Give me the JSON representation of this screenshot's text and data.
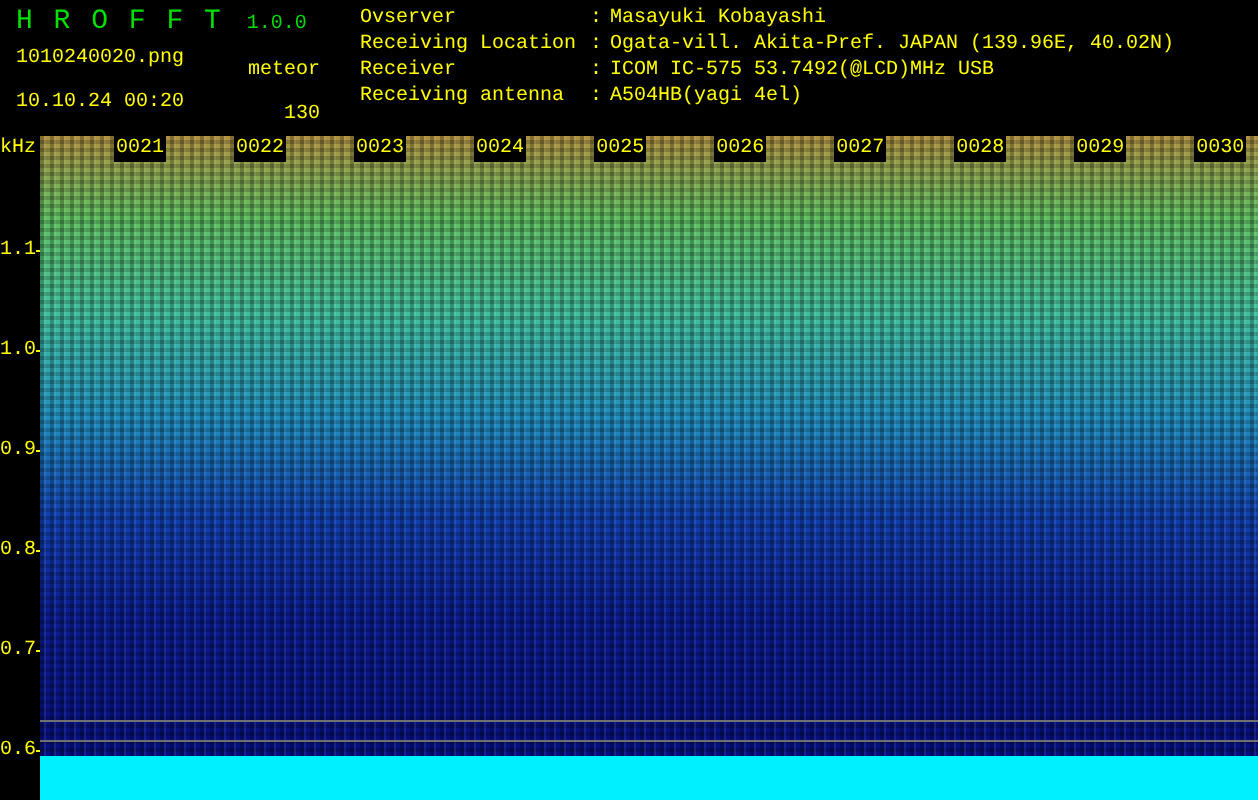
{
  "app": {
    "name": "H R O F F T",
    "version": "1.0.0"
  },
  "file": {
    "name": "1010240020.png",
    "datetime": "10.10.24 00:20"
  },
  "meteor": {
    "label": "meteor",
    "count": "130"
  },
  "info": [
    {
      "label": "Ovserver",
      "separator": ":",
      "value": "Masayuki Kobayashi"
    },
    {
      "label": "Receiving Location",
      "separator": ":",
      "value": "Ogata-vill. Akita-Pref. JAPAN (139.96E, 40.02N)"
    },
    {
      "label": "Receiver",
      "separator": ":",
      "value": "ICOM IC-575 53.7492(@LCD)MHz USB"
    },
    {
      "label": "Receiving antenna",
      "separator": ":",
      "value": "A504HB(yagi 4el)"
    }
  ],
  "spectrogram": {
    "unit": "kHz",
    "time_labels": [
      "0021",
      "0022",
      "0023",
      "0024",
      "0025",
      "0026",
      "0027",
      "0028",
      "0029",
      "0030"
    ],
    "frequency_labels": [
      "1.1",
      "1.0",
      "0.9",
      "0.8",
      "0.7",
      "0.6"
    ]
  }
}
